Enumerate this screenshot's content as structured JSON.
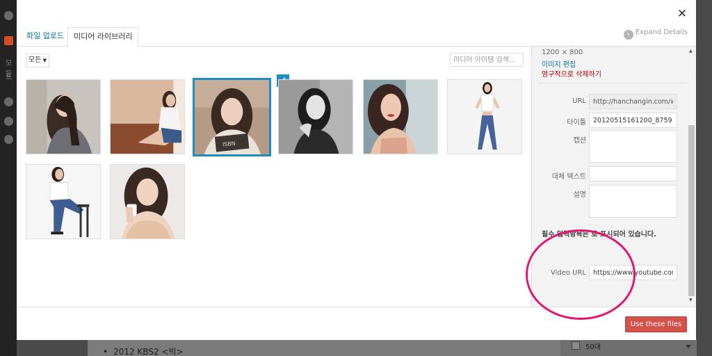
{
  "background": {
    "admin_labels": [
      "모든",
      "프"
    ],
    "list_item": "2012 KBS2 <빅>",
    "checkbox_label": "50대"
  },
  "tabs": {
    "upload": "파일 업로드",
    "library": "미디어 라이브러리"
  },
  "expand_details": "Expand Details",
  "filter": {
    "selected": "모든"
  },
  "search": {
    "placeholder": "미디어 아이템 검색..."
  },
  "grid": {
    "items": [
      {
        "icon": "photo-woman-sweater",
        "selected": false
      },
      {
        "icon": "photo-woman-floor",
        "selected": false
      },
      {
        "icon": "photo-woman-isbn",
        "selected": true
      },
      {
        "icon": "photo-woman-bw",
        "selected": false
      },
      {
        "icon": "photo-woman-lips",
        "selected": false
      },
      {
        "icon": "photo-woman-jeans",
        "selected": false
      },
      {
        "icon": "photo-woman-stool",
        "selected": false
      },
      {
        "icon": "photo-woman-cup",
        "selected": false
      }
    ]
  },
  "details": {
    "dimensions": "1200 × 800",
    "edit": "이미지 편집",
    "delete": "영구적으로 삭제하기",
    "url_label": "URL",
    "url_value": "http://hanchangin.com/wp-",
    "title_label": "타이틀",
    "title_value": "20120515161200_8759",
    "caption_label": "캡션",
    "caption_value": "",
    "alt_label": "대체 텍스트",
    "alt_value": "",
    "desc_label": "설명",
    "desc_value": "",
    "required_note": "필수 입력항목은 로 표시되어 있습니다.",
    "video_url_label": "Video URL",
    "video_url_value": "https://www.youtube.com/v"
  },
  "footer": {
    "use_button": "Use these files"
  },
  "colors": {
    "accent": "#0073aa",
    "selected_border": "#1e8cbe",
    "primary_button": "#d3534a",
    "annotation_circle": "#e2156f"
  }
}
